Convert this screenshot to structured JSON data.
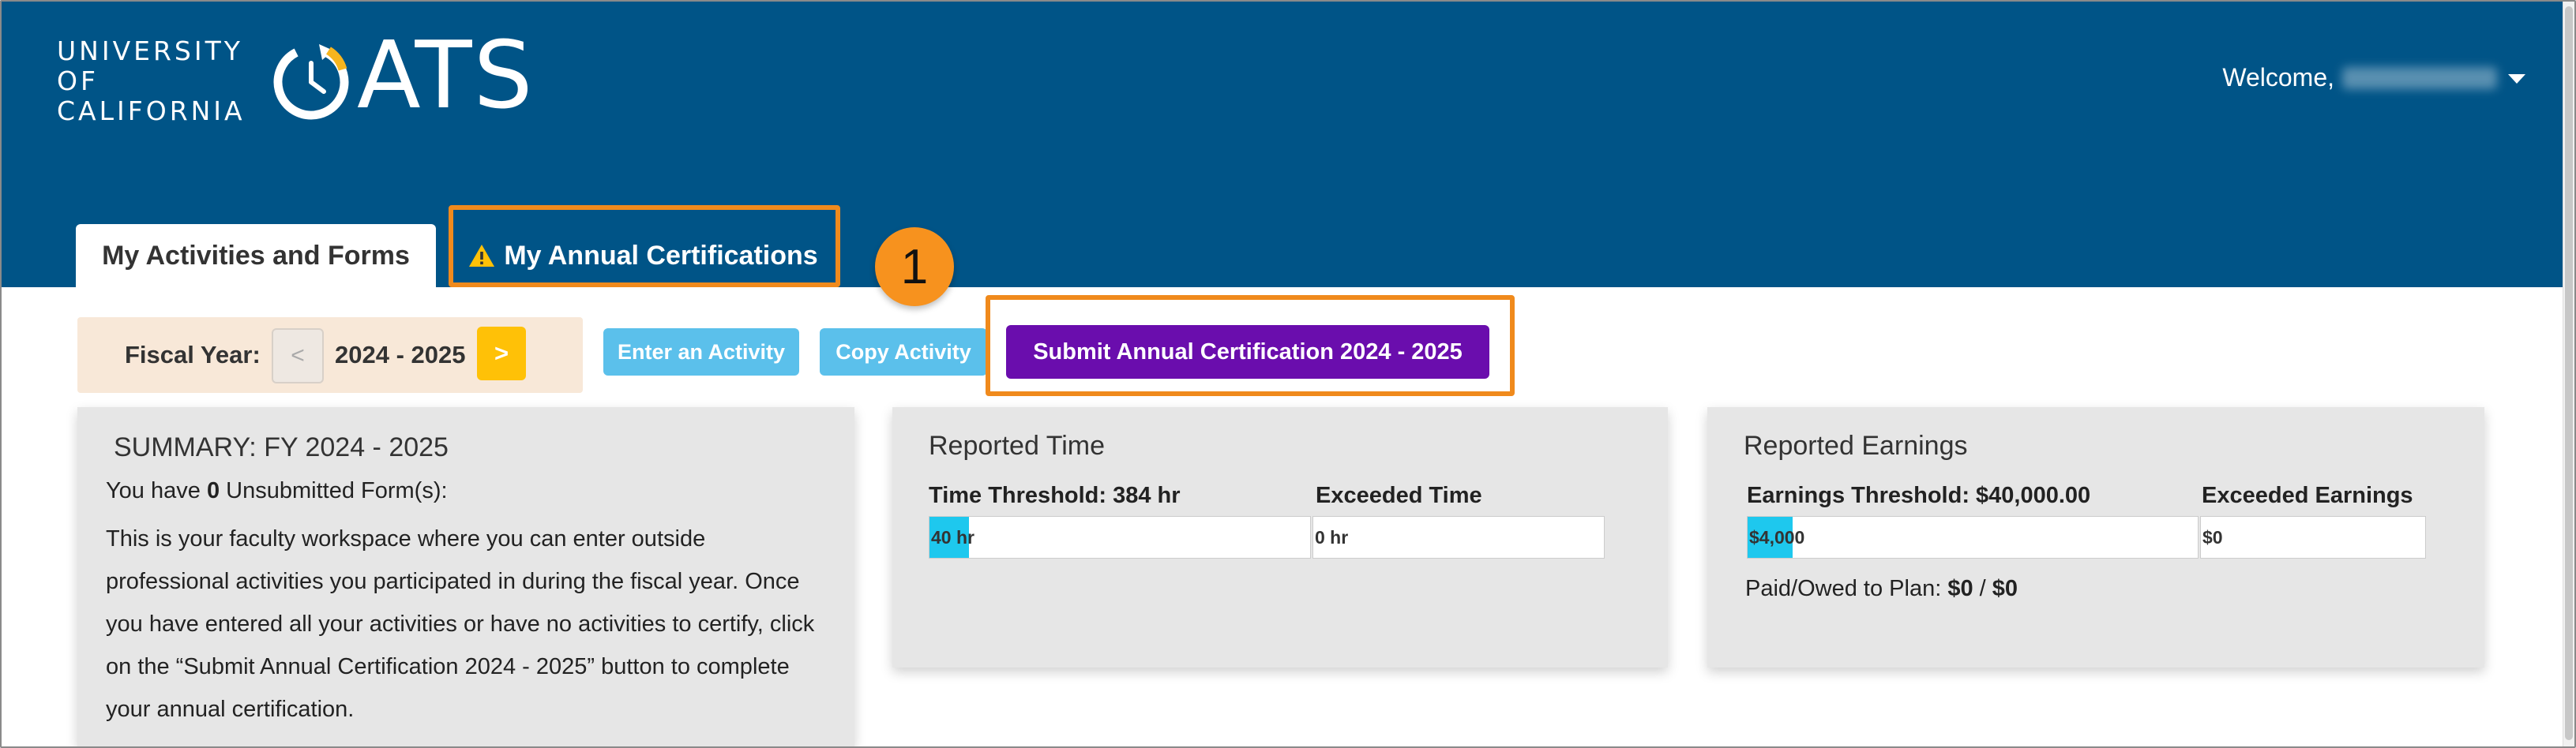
{
  "header": {
    "university_lines": [
      "UNIVERSITY",
      "OF",
      "CALIFORNIA"
    ],
    "app_name": "ATS",
    "welcome_label": "Welcome,"
  },
  "tabs": [
    {
      "label": "My Activities and Forms",
      "active": true
    },
    {
      "label": "My Annual Certifications",
      "active": false,
      "icon": "warning-icon"
    }
  ],
  "annotation": {
    "step_number": "1",
    "color": "#f08a1c"
  },
  "toolbar": {
    "fiscal_year_label": "Fiscal Year:",
    "prev_symbol": "<",
    "fiscal_year_value": "2024 - 2025",
    "next_symbol": ">",
    "enter_activity_label": "Enter an Activity",
    "copy_activity_label": "Copy Activity",
    "submit_label": "Submit Annual Certification 2024 - 2025"
  },
  "summary": {
    "title": "SUMMARY: FY 2024 - 2025",
    "prefix": "You have",
    "count": "0",
    "suffix": "Unsubmitted Form(s):",
    "description": "This is your faculty workspace where you can enter outside professional activities you participated in during the fiscal year. Once you have entered all your activities or have no activities to certify, click on the “Submit Annual Certification 2024 - 2025” button to complete your annual certification."
  },
  "reported_time": {
    "title": "Reported Time",
    "threshold_label": "Time Threshold: 384 hr",
    "exceeded_label": "Exceeded Time",
    "threshold_value": "40 hr",
    "threshold_fraction": 0.104,
    "exceeded_value": "0 hr"
  },
  "reported_earnings": {
    "title": "Reported Earnings",
    "threshold_label": "Earnings Threshold: $40,000.00",
    "exceeded_label": "Exceeded Earnings",
    "threshold_value": "$4,000",
    "threshold_fraction": 0.1,
    "exceeded_value": "$0",
    "paid_label": "Paid/Owed to Plan:",
    "paid_value": "$0",
    "paid_separator": "/",
    "owed_value": "$0"
  },
  "colors": {
    "header_bg": "#005487",
    "accent_yellow": "#ffc107",
    "button_light_blue": "#5bc0eb",
    "submit_purple": "#6a0dad",
    "bar_fill": "#1ec8ee"
  }
}
